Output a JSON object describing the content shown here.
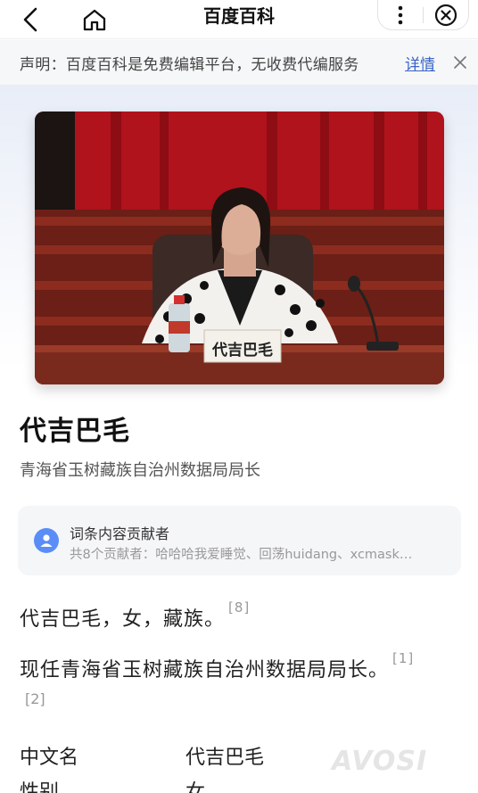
{
  "topbar": {
    "back_icon": "chevron-left-icon",
    "home_icon": "home-icon",
    "title": "百度百科",
    "more_icon": "more-vertical-icon",
    "close_icon": "close-circle-icon"
  },
  "notice": {
    "text": "声明：百度百科是免费编辑平台，无收费代编服务",
    "link": "详情",
    "dismiss_icon": "close-icon"
  },
  "hero": {
    "nameplate": "代吉巴毛"
  },
  "entry": {
    "name": "代吉巴毛",
    "subtitle": "青海省玉树藏族自治州数据局局长"
  },
  "contributors": {
    "title": "词条内容贡献者",
    "list": "共8个贡献者：哈哈哈我爱睡觉、回荡huidang、xcmask…"
  },
  "paragraphs": [
    {
      "text": "代吉巴毛，女，藏族。",
      "ref": "[8]"
    },
    {
      "text": "现任青海省玉树藏族自治州数据局局长。",
      "ref": "[1]",
      "ref2": "[2]"
    }
  ],
  "basic_info": [
    {
      "key": "中文名",
      "value": "代吉巴毛"
    },
    {
      "key": "性别",
      "value": "女"
    }
  ],
  "watermark": "AVOSI",
  "colors": {
    "link": "#3a64c8",
    "accent": "#5b8df7"
  }
}
